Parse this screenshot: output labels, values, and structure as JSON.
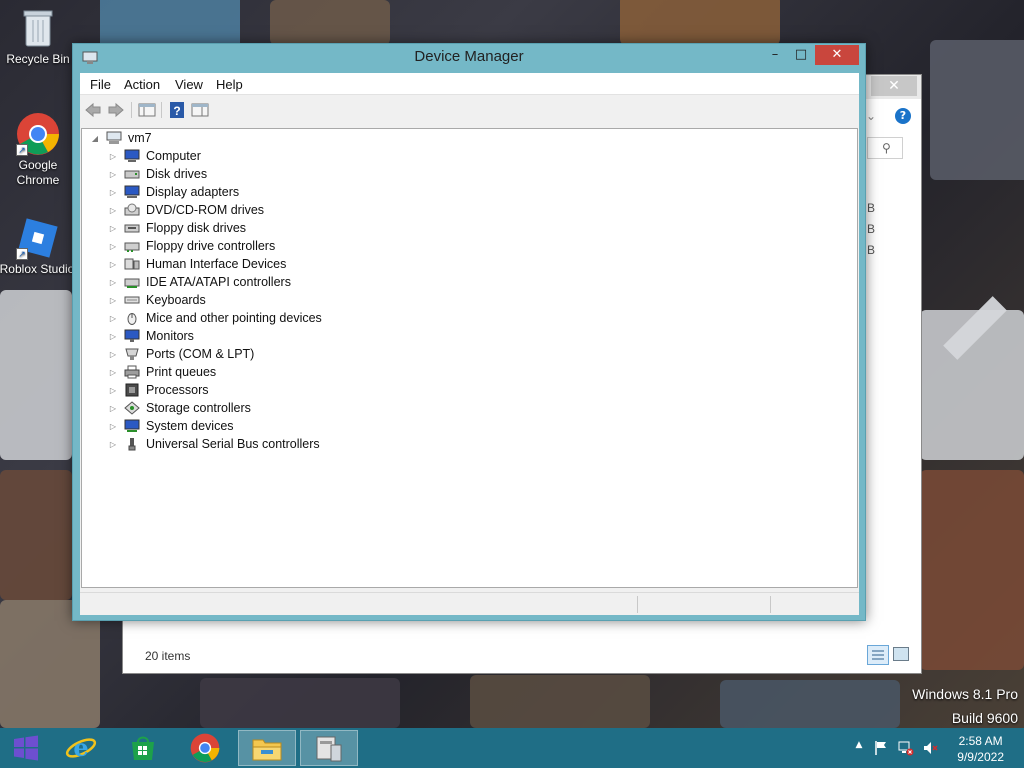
{
  "desktop": {
    "icons": [
      {
        "label": "Recycle Bin",
        "icon": "recycle-bin-icon"
      },
      {
        "label": "Google\nChrome",
        "icon": "chrome-icon"
      },
      {
        "label": "Roblox Studio",
        "icon": "roblox-studio-icon"
      }
    ],
    "watermark": {
      "line1": "Windows 8.1 Pro",
      "line2": "Build 9600"
    }
  },
  "background_window": {
    "status": "20 items",
    "fragments": [
      "B",
      "B",
      "B"
    ]
  },
  "device_manager": {
    "title": "Device Manager",
    "window_controls": {
      "minimize": "–",
      "maximize": "□",
      "close": "✕"
    },
    "menu": [
      "File",
      "Action",
      "View",
      "Help"
    ],
    "toolbar": [
      "back-arrow-icon",
      "forward-arrow-icon",
      "show-hide-console-tree-icon",
      "help-icon",
      "properties-icon"
    ],
    "tree": {
      "root": "vm7",
      "items": [
        {
          "label": "Computer",
          "icon": "computer-icon"
        },
        {
          "label": "Disk drives",
          "icon": "disk-drive-icon"
        },
        {
          "label": "Display adapters",
          "icon": "display-adapter-icon"
        },
        {
          "label": "DVD/CD-ROM drives",
          "icon": "dvd-drive-icon"
        },
        {
          "label": "Floppy disk drives",
          "icon": "floppy-disk-icon"
        },
        {
          "label": "Floppy drive controllers",
          "icon": "floppy-controller-icon"
        },
        {
          "label": "Human Interface Devices",
          "icon": "hid-icon"
        },
        {
          "label": "IDE ATA/ATAPI controllers",
          "icon": "ide-controller-icon"
        },
        {
          "label": "Keyboards",
          "icon": "keyboard-icon"
        },
        {
          "label": "Mice and other pointing devices",
          "icon": "mouse-icon"
        },
        {
          "label": "Monitors",
          "icon": "monitor-icon"
        },
        {
          "label": "Ports (COM & LPT)",
          "icon": "port-icon"
        },
        {
          "label": "Print queues",
          "icon": "printer-icon"
        },
        {
          "label": "Processors",
          "icon": "processor-icon"
        },
        {
          "label": "Storage controllers",
          "icon": "storage-controller-icon"
        },
        {
          "label": "System devices",
          "icon": "system-device-icon"
        },
        {
          "label": "Universal Serial Bus controllers",
          "icon": "usb-icon"
        }
      ]
    }
  },
  "taskbar": {
    "apps": [
      "start-icon",
      "internet-explorer-icon",
      "store-icon",
      "chrome-icon",
      "file-explorer-icon",
      "device-manager-icon"
    ],
    "tray": [
      "show-hidden-icons-icon",
      "action-center-flag-icon",
      "network-disconnected-icon",
      "volume-muted-icon"
    ],
    "time": "2:58 AM",
    "date": "9/9/2022"
  },
  "colors": {
    "window_frame": "#74b8c7",
    "close_button": "#c9463d",
    "taskbar": "#1f6e86"
  }
}
